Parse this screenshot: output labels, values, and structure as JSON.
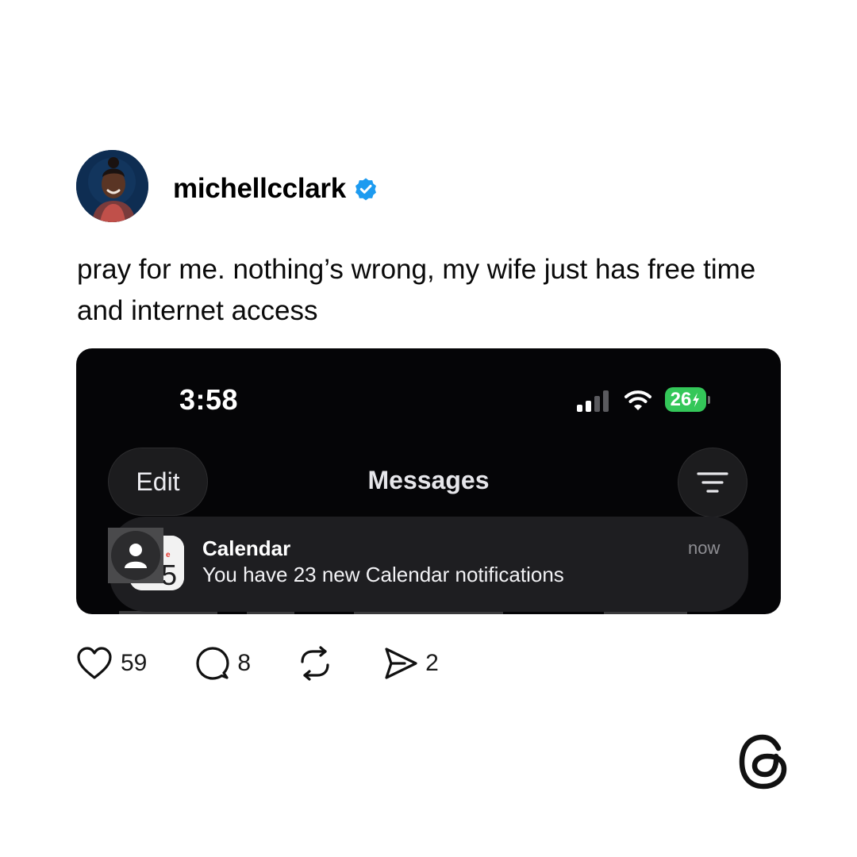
{
  "post": {
    "username": "michellcclark",
    "text": "pray for me. nothing’s wrong, my wife just has free time and internet access"
  },
  "screenshot": {
    "status_bar": {
      "time": "3:58",
      "battery": "26"
    },
    "nav": {
      "edit_label": "Edit",
      "title": "Messages"
    },
    "notification": {
      "app": "Calendar",
      "message": "You have 23 new Calendar notifications",
      "time": "now"
    }
  },
  "actions": {
    "likes": "59",
    "replies": "8",
    "shares": "2"
  },
  "colors": {
    "verified": "#1d9bf0",
    "battery": "#34c759",
    "screenshot_bg": "#050507",
    "notification_bg": "#1e1e21"
  },
  "icons": [
    "verified-badge-icon",
    "cellular-signal-icon",
    "wifi-icon",
    "battery-icon",
    "filter-lines-icon",
    "calendar-app-icon",
    "person-icon",
    "heart-icon",
    "comment-icon",
    "repost-icon",
    "send-icon",
    "threads-logo"
  ]
}
